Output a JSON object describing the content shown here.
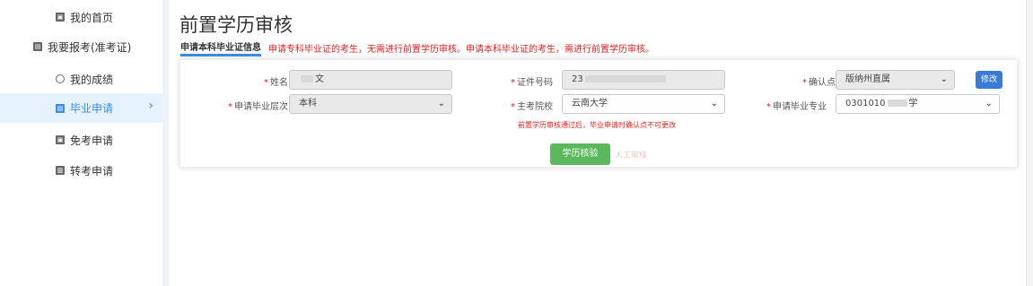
{
  "sidebar": {
    "items": [
      {
        "label": "我的首页",
        "icon": "home-icon"
      },
      {
        "label": "我要报考(准考证)",
        "icon": "register-icon"
      },
      {
        "label": "我的成绩",
        "icon": "scores-icon"
      },
      {
        "label": "毕业申请",
        "icon": "graduation-icon",
        "active": true
      },
      {
        "label": "免考申请",
        "icon": "exemption-icon"
      },
      {
        "label": "转考申请",
        "icon": "transfer-icon"
      }
    ]
  },
  "page": {
    "title": "前置学历审核",
    "tab_active": "申请本科毕业证信息",
    "notice": "申请专科毕业证的考生，无需进行前置学历审核。申请本科毕业证的考生，需进行前置学历审核。"
  },
  "form": {
    "name_label": "姓名",
    "name_value_prefix": "",
    "name_value_suffix": "文",
    "id_label": "证件号码",
    "id_value_prefix": "23",
    "confirm_label": "确认点",
    "confirm_value": "版纳州直属",
    "modify_button": "修改",
    "level_label": "申请毕业层次",
    "level_value": "本科",
    "school_label": "主考院校",
    "school_value": "云南大学",
    "major_label": "申请毕业专业",
    "major_value_prefix": "0301010",
    "major_value_suffix": "学",
    "warning": "前置学历审核通过后，毕业申请时确认点不可更改",
    "verify_button": "学历核验",
    "manual_review": "人工审核"
  },
  "colors": {
    "accent": "#3a8ee6",
    "warning": "#e02020",
    "verify": "#5cb85c"
  }
}
